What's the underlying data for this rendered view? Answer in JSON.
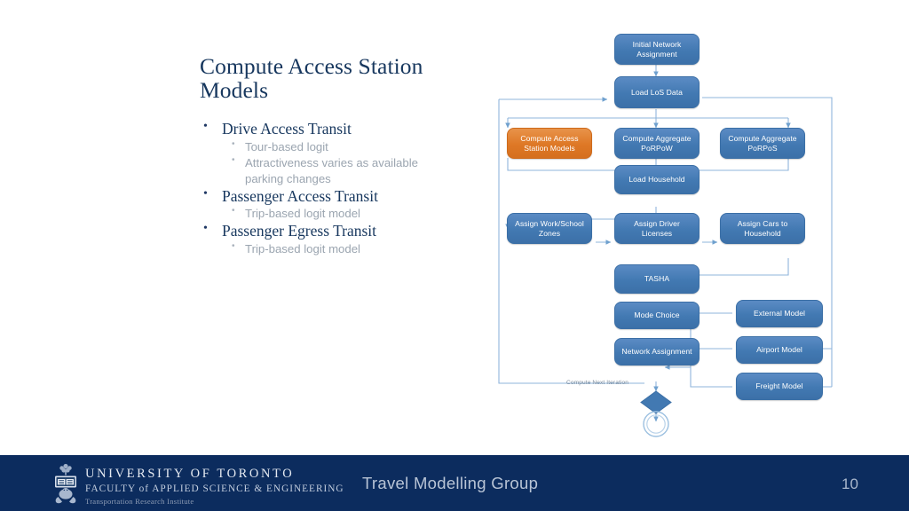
{
  "slide": {
    "title": "Compute Access Station Models",
    "bullets": [
      {
        "label": "Drive Access Transit",
        "sub": [
          "Tour-based logit",
          "Attractiveness varies as available",
          "parking changes"
        ]
      },
      {
        "label": "Passenger Access Transit",
        "sub": [
          "Trip-based logit model"
        ]
      },
      {
        "label": "Passenger Egress Transit",
        "sub": [
          "Trip-based logit model"
        ]
      }
    ]
  },
  "flowchart": {
    "iteration_label": "Compute Next Iteration",
    "nodes": {
      "initial_network_assignment": "Initial Network Assignment",
      "load_los_data": "Load LoS Data",
      "compute_access_station_models": "Compute Access Station Models",
      "compute_aggregate_porpow": "Compute Aggregate PoRPoW",
      "compute_aggregate_porpos": "Compute Aggregate PoRPoS",
      "load_household": "Load Household",
      "assign_work_school_zones": "Assign Work/School Zones",
      "assign_driver_licenses": "Assign Driver Licenses",
      "assign_cars_to_household": "Assign Cars to Household",
      "tasha": "TASHA",
      "mode_choice": "Mode Choice",
      "network_assignment": "Network Assignment",
      "external_model": "External Model",
      "airport_model": "Airport Model",
      "freight_model": "Freight Model"
    },
    "colors": {
      "node_blue": "#4279B2",
      "node_orange": "#DE7826",
      "connector": "#7FA9D4",
      "highlight": "#DE7826"
    }
  },
  "footer": {
    "logo_line1": "UNIVERSITY OF TORONTO",
    "logo_line2": "FACULTY of APPLIED SCIENCE & ENGINEERING",
    "logo_line3": "Transportation Research Institute",
    "title": "Travel Modelling Group",
    "page_number": "10",
    "background_color": "#0C2C5E"
  }
}
